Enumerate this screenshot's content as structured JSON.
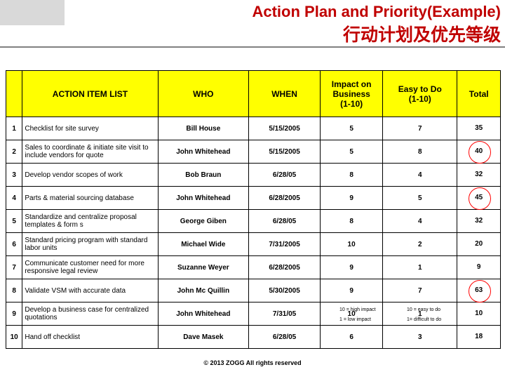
{
  "slide": {
    "title_en": "Action Plan and Priority(Example)",
    "title_cn": "行动计划及优先等级",
    "footer": "© 2013 ZOGG  All rights reserved"
  },
  "table": {
    "headers": {
      "num": "",
      "item": "ACTION ITEM LIST",
      "who": "WHO",
      "when": "WHEN",
      "impact": "Impact on Business (1-10)",
      "impact_line1": "Impact on",
      "impact_line2": "Business",
      "impact_line3": "(1-10)",
      "easy": "Easy to Do (1-10)",
      "easy_line1": "Easy to Do",
      "easy_line2": "(1-10)",
      "total": "Total"
    },
    "rows": [
      {
        "num": "1",
        "item": "Checklist for site survey",
        "who": "Bill House",
        "when": "5/15/2005",
        "impact": "5",
        "easy": "7",
        "total": "35",
        "circled": false
      },
      {
        "num": "2",
        "item": "Sales to coordinate & initiate site visit to include vendors for quote",
        "who": "John Whitehead",
        "when": "5/15/2005",
        "impact": "5",
        "easy": "8",
        "total": "40",
        "circled": true
      },
      {
        "num": "3",
        "item": "Develop vendor scopes of work",
        "who": "Bob Braun",
        "when": "6/28/05",
        "impact": "8",
        "easy": "4",
        "total": "32",
        "circled": false
      },
      {
        "num": "4",
        "item": "Parts & material sourcing database",
        "who": "John Whitehead",
        "when": "6/28/2005",
        "impact": "9",
        "easy": "5",
        "total": "45",
        "circled": true
      },
      {
        "num": "5",
        "item": "Standardize and centralize proposal templates & form s",
        "who": "George Giben",
        "when": "6/28/05",
        "impact": "8",
        "easy": "4",
        "total": "32",
        "circled": false
      },
      {
        "num": "6",
        "item": "Standard pricing program with standard labor units",
        "who": "Michael Wide",
        "when": "7/31/2005",
        "impact": "10",
        "easy": "2",
        "total": "20",
        "circled": false
      },
      {
        "num": "7",
        "item": "Communicate customer need for more responsive legal review",
        "who": "Suzanne Weyer",
        "when": "6/28/2005",
        "impact": "9",
        "easy": "1",
        "total": "9",
        "circled": false
      },
      {
        "num": "8",
        "item": "Validate VSM with accurate data",
        "who": "John Mc Quillin",
        "when": "5/30/2005",
        "impact": "9",
        "easy": "7",
        "total": "63",
        "circled": true
      },
      {
        "num": "9",
        "item": "Develop a business case for centralized quotations",
        "who": "John Whitehead",
        "when": "7/31/05",
        "impact": "10",
        "easy": "1",
        "total": "10",
        "circled": false
      },
      {
        "num": "10",
        "item": "Hand off checklist",
        "who": "Dave Masek",
        "when": "6/28/05",
        "impact": "6",
        "easy": "3",
        "total": "18",
        "circled": false
      }
    ]
  },
  "notes": {
    "impact_high": "10 = high impact",
    "impact_low": "1 = low impact",
    "easy_high": "10 = easy to do",
    "easy_low": "1= difficult to do"
  }
}
